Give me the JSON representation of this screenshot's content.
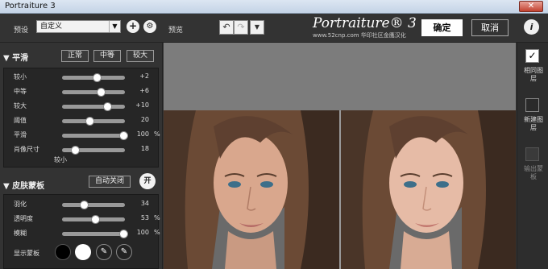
{
  "window": {
    "title": "Portraiture 3",
    "close": "✕"
  },
  "topbar": {
    "preset_label": "预设",
    "preset_value": "自定义",
    "add": "+",
    "gear": "⚙",
    "preview_label": "预览",
    "logo": "Portraiture® 3",
    "logo_sub": "www.52cnp.com  华印社区金鹰汉化",
    "ok": "确定",
    "cancel": "取消",
    "info": "i"
  },
  "smoothing": {
    "title": "平滑",
    "buttons": [
      "正常",
      "中等",
      "较大"
    ],
    "sliders": [
      {
        "label": "较小",
        "value": "+2",
        "unit": "",
        "level": 0.55
      },
      {
        "label": "中等",
        "value": "+6",
        "unit": "",
        "level": 0.62
      },
      {
        "label": "较大",
        "value": "+10",
        "unit": "",
        "level": 0.72
      },
      {
        "label": "阈值",
        "value": "20",
        "unit": "",
        "level": 0.44
      },
      {
        "label": "平滑",
        "value": "100",
        "unit": "%",
        "level": 0.97
      },
      {
        "label": "肖像尺寸",
        "value": "18",
        "unit": "",
        "level": 0.2
      }
    ],
    "footer": "较小"
  },
  "skinmask": {
    "title": "皮肤蒙板",
    "auto_button": "自动关闭",
    "toggle": "开",
    "sliders": [
      {
        "label": "羽化",
        "value": "34",
        "unit": "",
        "level": 0.34
      },
      {
        "label": "透明度",
        "value": "53",
        "unit": "%",
        "level": 0.53
      },
      {
        "label": "模糊",
        "value": "100",
        "unit": "%",
        "level": 0.97
      }
    ],
    "show_mask": "显示蒙板"
  },
  "right": {
    "items": [
      "相同图层",
      "新建图层",
      "输出蒙板"
    ]
  }
}
